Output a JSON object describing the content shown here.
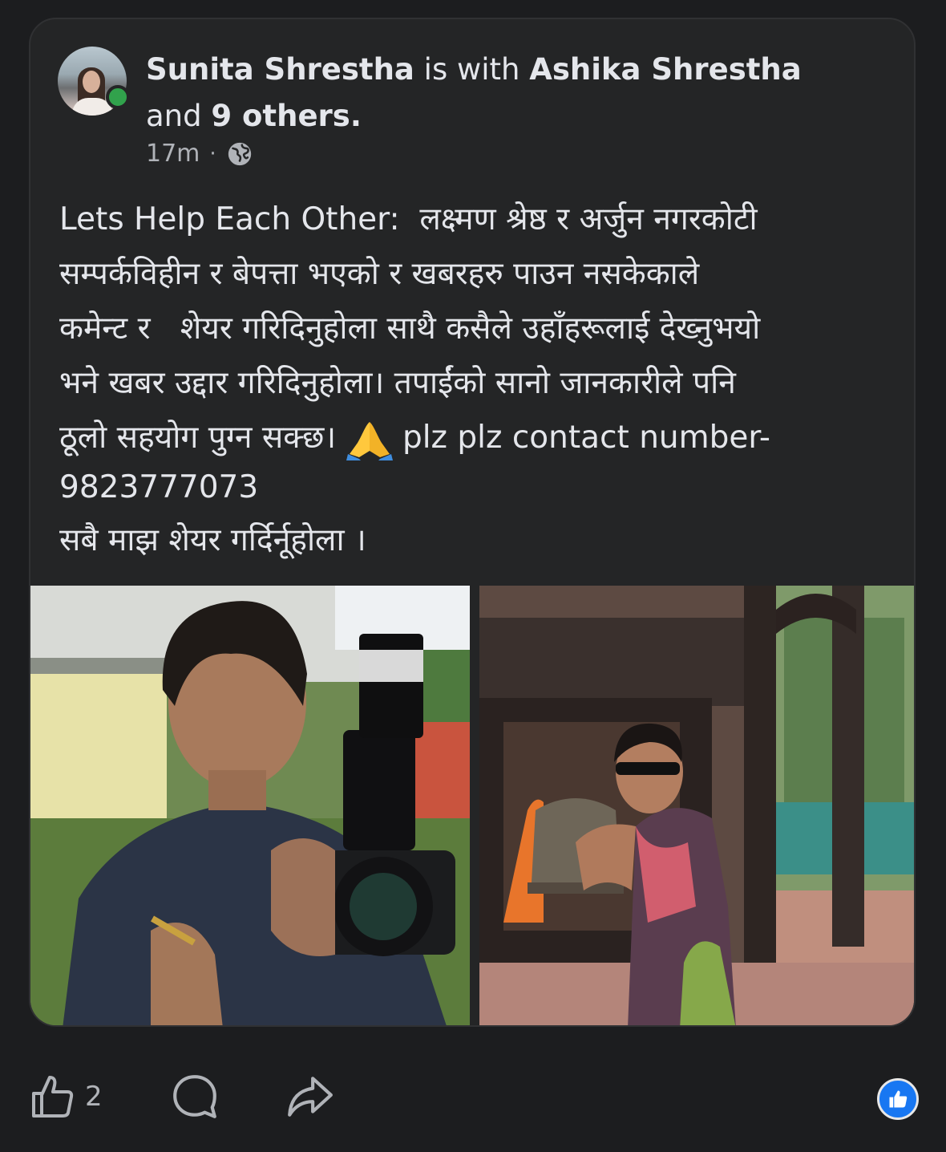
{
  "post": {
    "author": "Sunita Shrestha",
    "with_text": " is with ",
    "tagged": "Ashika Shrestha",
    "and_text": "and ",
    "others": "9 others.",
    "time": "17m",
    "separator": "·",
    "privacy_icon": "globe-icon",
    "body_lines": [
      "Lets Help Each Other:  लक्ष्मण श्रेष्ठ र अर्जुन नगरकोटी",
      "सम्पर्कविहीन र बेपत्ता भएको र खबरहरु पाउन नसकेकाले",
      "कमेन्ट र   शेयर गरिदिनुहोला साथै कसैले उहाँहरूलाई देख्नुभयो",
      "भने खबर उद्दार गरिदिनुहोला। तपाईंको सानो जानकारीले पनि",
      "ठूलो सहयोग पुग्न सक्छ। "
    ],
    "body_line5_tail": " plz plz contact number-",
    "phone": "9823777073",
    "body_last": "सबै माझ शेयर गर्दिर्नूहोला ।",
    "emoji": "folded-hands-emoji"
  },
  "photos": [
    {
      "description_icon": "photo-man-with-camera"
    },
    {
      "description_icon": "photo-man-at-temple-bell"
    }
  ],
  "actions": {
    "like_icon": "thumbs-up-icon",
    "like_count": "2",
    "comment_icon": "comment-bubble-icon",
    "share_icon": "share-arrow-icon",
    "reaction_icon": "like-reaction-badge-icon"
  },
  "colors": {
    "background": "#1c1d1f",
    "card": "#242526",
    "text": "#e4e6eb",
    "muted": "#b0b3b8",
    "online": "#31a24c",
    "like_blue": "#1877f2"
  }
}
